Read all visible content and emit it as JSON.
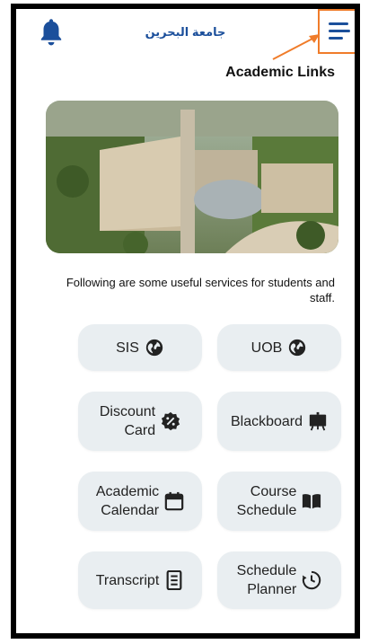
{
  "header": {
    "app_title": "جامعة البحرين",
    "bell_icon": "bell-icon",
    "menu_icon": "hamburger-menu-icon"
  },
  "section": {
    "title": "Academic Links",
    "description": "Following are some useful services for students and staff."
  },
  "colors": {
    "accent_blue": "#1b4f9b",
    "highlight_orange": "#f07c2a",
    "button_bg": "#e9eef1"
  },
  "links": [
    {
      "label": "SIS",
      "icon": "globe-icon"
    },
    {
      "label": "UOB",
      "icon": "globe-icon"
    },
    {
      "label": "Discount\nCard",
      "icon": "discount-badge-icon"
    },
    {
      "label": "Blackboard",
      "icon": "chalkboard-icon"
    },
    {
      "label": "Academic\nCalendar",
      "icon": "calendar-icon"
    },
    {
      "label": "Course\nSchedule",
      "icon": "book-icon"
    },
    {
      "label": "Transcript",
      "icon": "document-icon"
    },
    {
      "label": "Schedule\nPlanner",
      "icon": "clock-icon"
    }
  ]
}
